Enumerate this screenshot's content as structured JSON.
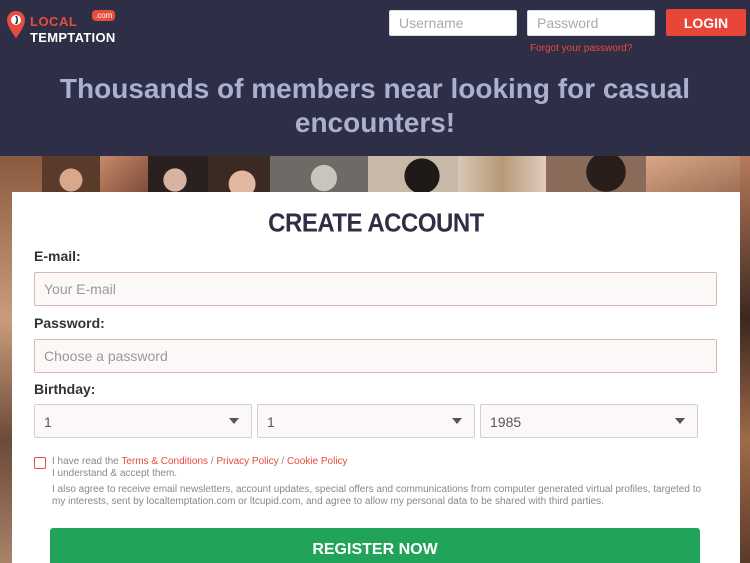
{
  "logo": {
    "word1": "LOCAL",
    "word2": "TEMPTATION",
    "badge": ".com"
  },
  "header": {
    "username_placeholder": "Username",
    "password_placeholder": "Password",
    "login_label": "LOGIN",
    "forgot_link": "Forgot your password?",
    "headline_line1": "Thousands of members near looking for casual",
    "headline_line2": "encounters!"
  },
  "form": {
    "title": "CREATE ACCOUNT",
    "email_label": "E-mail:",
    "email_placeholder": "Your E-mail",
    "password_label": "Password:",
    "password_placeholder": "Choose a password",
    "birthday_label": "Birthday:",
    "birthday_day": "1",
    "birthday_month": "1",
    "birthday_year": "1985",
    "terms_prefix": "I have read the ",
    "terms_link": "Terms & Conditions",
    "sep1": " / ",
    "privacy_link": "Privacy Policy",
    "sep2": " / ",
    "cookie_link": "Cookie Policy",
    "accept_text": "I understand & accept them.",
    "consent_text": "I also agree to receive email newsletters, account updates, special offers and communications from computer generated virtual profiles, targeted to my interests, sent by localtemptation.com or ltcupid.com, and agree to allow my personal data to be shared with third parties.",
    "register_label": "REGISTER NOW"
  },
  "colors": {
    "brand": "#e9463a",
    "header_bg": "#2e2e46",
    "cta": "#21a35a"
  }
}
